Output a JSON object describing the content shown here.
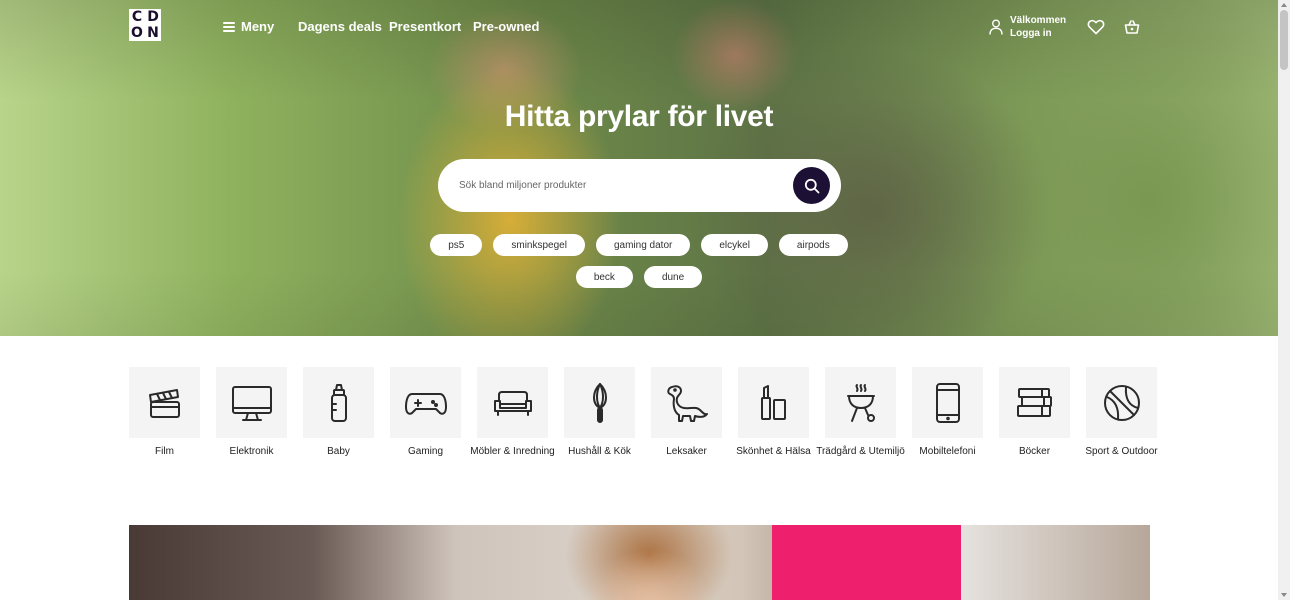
{
  "header": {
    "logo_letters": [
      "C",
      "D",
      "O",
      "N"
    ],
    "menu_label": "Meny",
    "nav": [
      "Dagens deals",
      "Presentkort",
      "Pre-owned"
    ],
    "account_line1": "Välkommen",
    "account_line2": "Logga in"
  },
  "hero": {
    "headline": "Hitta prylar för livet",
    "search_placeholder": "Sök bland miljoner produkter",
    "chips_row1": [
      "ps5",
      "sminkspegel",
      "gaming dator",
      "elcykel",
      "airpods"
    ],
    "chips_row2": [
      "beck",
      "dune"
    ]
  },
  "categories": [
    {
      "label": "Film",
      "icon": "film-clapper-icon"
    },
    {
      "label": "Elektronik",
      "icon": "monitor-icon"
    },
    {
      "label": "Baby",
      "icon": "baby-bottle-icon"
    },
    {
      "label": "Gaming",
      "icon": "gamepad-icon"
    },
    {
      "label": "Möbler & Inredning",
      "icon": "sofa-icon"
    },
    {
      "label": "Hushåll & Kök",
      "icon": "whisk-icon"
    },
    {
      "label": "Leksaker",
      "icon": "dinosaur-icon"
    },
    {
      "label": "Skönhet & Hälsa",
      "icon": "cosmetics-icon"
    },
    {
      "label": "Trädgård & Utemiljö",
      "icon": "grill-icon"
    },
    {
      "label": "Mobiltelefoni",
      "icon": "mobile-phone-icon"
    },
    {
      "label": "Böcker",
      "icon": "books-icon"
    },
    {
      "label": "Sport & Outdoor",
      "icon": "ball-icon"
    }
  ],
  "colors": {
    "brand_dark": "#1d1035",
    "banner_pink": "#ee1f6d",
    "tile_bg": "#f4f4f4"
  }
}
